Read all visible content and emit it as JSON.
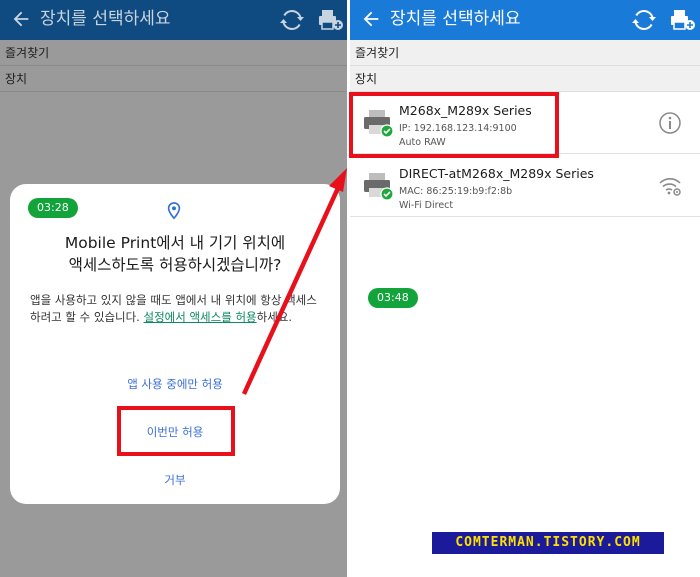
{
  "left_screen": {
    "title": "장치를 선택하세요",
    "favorites_header": "즐겨찾기",
    "devices_header": "장치",
    "dialog": {
      "timer": "03:28",
      "title_line1": "Mobile Print에서 내 기기 위치에",
      "title_line2": "액세스하도록 허용하시겠습니까?",
      "body_text": "앱을 사용하고 있지 않을 때도 앱에서 내 위치에 항상 액세스하려고 할 수 있습니다. ",
      "body_link": "설정에서 액세스를 허용",
      "body_suffix": "하세요.",
      "buttons": {
        "while_using": "앱 사용 중에만 허용",
        "only_this_time": "이번만 허용",
        "deny": "거부"
      }
    }
  },
  "right_screen": {
    "title": "장치를 선택하세요",
    "favorites_header": "즐겨찾기",
    "devices_header": "장치",
    "timer": "03:48",
    "devices": [
      {
        "name": "M268x_M289x Series",
        "address": "IP: 192.168.123.14:9100",
        "type": "Auto RAW",
        "action_icon": "info-icon"
      },
      {
        "name": "DIRECT-atM268x_M289x Series",
        "address": "MAC: 86:25:19:b9:f2:8b",
        "type": "Wi-Fi Direct",
        "action_icon": "wifi-settings-icon"
      }
    ]
  },
  "watermark": "COMTERMAN.TISTORY.COM",
  "colors": {
    "app_bar": "#1a7ad8",
    "app_bar_dimmed": "#0f4a80",
    "highlight": "#e8111b",
    "timer_badge": "#12a33a",
    "dialog_button": "#3b6fd6",
    "link": "#0d8a62"
  }
}
